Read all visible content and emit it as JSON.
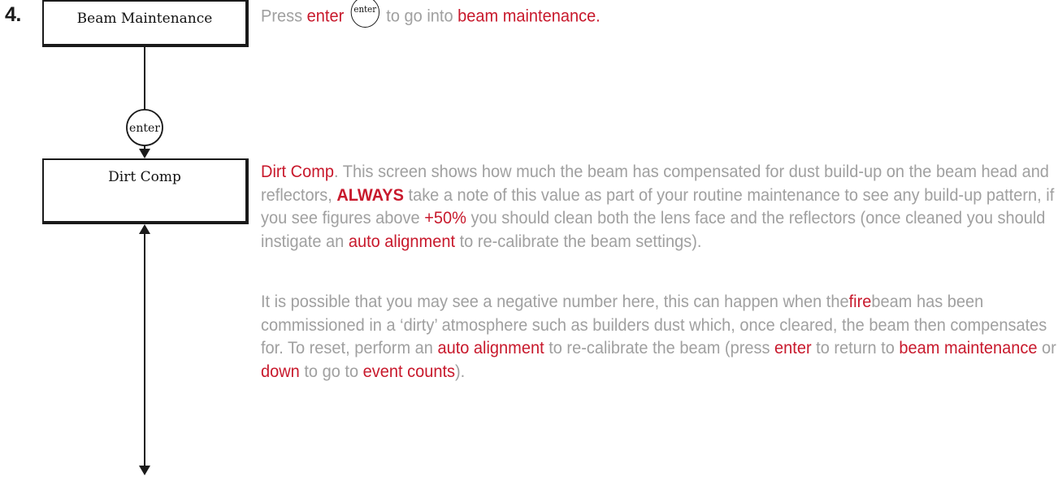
{
  "step": {
    "number": "4."
  },
  "menu": {
    "beam_maintenance": "Beam Maintenance",
    "dirt_comp": "Dirt Comp",
    "enter_key": "enter"
  },
  "intro": {
    "press": "Press ",
    "enter": "enter",
    "key_label": "enter",
    "to_go_into": " to go into ",
    "beam_maintenance": "beam maintenance."
  },
  "dirt_paragraph": {
    "title": "Dirt Comp",
    "t1": ". This screen shows how much the beam has compensated for dust build-up on the beam head and reflectors, ",
    "always": "ALWAYS",
    "t2": " take a note of this value as part of your routine maintenance to see any build-up pattern, if you see figures above ",
    "threshold": "+50%",
    "t3": " you should clean both the lens face and the reflectors (once cleaned you should instigate an ",
    "auto_alignment": "auto alignment",
    "t4": " to re-calibrate the beam  settings)."
  },
  "negative_paragraph": {
    "t1": "It is possible that you may see a negative number here, this can happen when the",
    "fire": "fire",
    "t2": "beam has been commissioned in a ‘dirty’ atmosphere such as builders dust which, once cleared, the beam then compensates for. To reset, perform an ",
    "auto_alignment": "auto alignment",
    "t3": " to re-calibrate the beam (press ",
    "enter": "enter",
    "t4": " to return to ",
    "beam_maintenance": "beam maintenance",
    "t5": " or ",
    "down": "down",
    "t6": " to go to ",
    "event_counts": "event counts",
    "t7": ")."
  },
  "colors": {
    "accent_red": "#c8192c",
    "body_grey": "#a0a0a0",
    "line_black": "#1a1a1a"
  }
}
